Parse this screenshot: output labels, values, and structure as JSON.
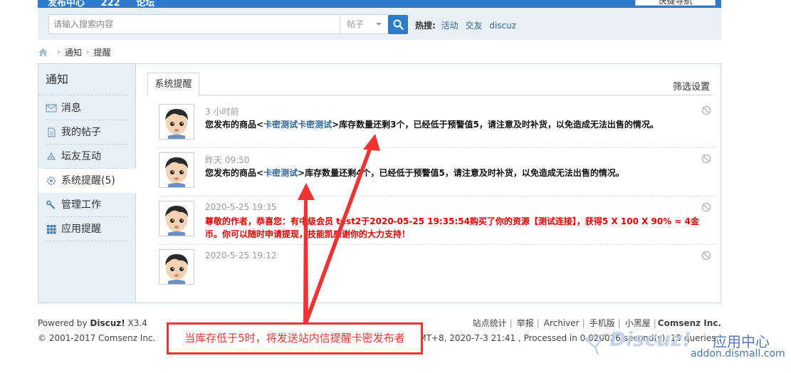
{
  "topbar": {
    "nav": [
      "发布中心",
      "222",
      "论坛"
    ],
    "quick_btn": "快捷导航"
  },
  "search": {
    "placeholder": "请输入搜索内容",
    "type": "帖子",
    "hot_label": "热搜:",
    "hot_keywords": [
      "活动",
      "交友",
      "discuz"
    ]
  },
  "breadcrumb": {
    "items": [
      "通知",
      "提醒"
    ],
    "separator": "›"
  },
  "sidebar": {
    "title": "通知",
    "items": [
      {
        "label": "消息",
        "icon": "mail-icon"
      },
      {
        "label": "我的帖子",
        "icon": "document-icon"
      },
      {
        "label": "坛友互动",
        "icon": "interaction-icon"
      },
      {
        "label": "系统提醒(5)",
        "icon": "gear-icon",
        "active": true
      },
      {
        "label": "管理工作",
        "icon": "wrench-icon"
      },
      {
        "label": "应用提醒",
        "icon": "grid-icon"
      }
    ]
  },
  "tabs": {
    "active": "系统提醒",
    "filter": "筛选设置"
  },
  "notices": [
    {
      "time": "3 小时前",
      "prefix": "您发布的商品<",
      "link": "卡密测试卡密测试",
      "suffix": ">库存数量还剩3个，已经低于预警值5，请注意及时补货，以免造成无法出售的情况。"
    },
    {
      "time": "昨天 09:50",
      "prefix": "您发布的商品<",
      "link": "卡密测试",
      "suffix": ">库存数量还剩4个，已经低于预警值5，请注意及时补货，以免造成无法出售的情况。"
    },
    {
      "time": "2020-5-25 19:35",
      "red_text": "尊敬的作者，恭喜您：有中级会员 test2于2020-05-25 19:35:54购买了你的资源【测试连接】，获得5 X 100 X 90% ≈ 4金币。你可以随时申请提现，技能凯感谢你的大力支持！"
    },
    {
      "time": "2020-5-25 19:12"
    }
  ],
  "footer": {
    "powered_prefix": "Powered by ",
    "powered_brand": "Discuz!",
    "powered_version": " X3.4",
    "copyright": "© 2001-2017 Comsenz Inc.",
    "links": [
      "站点统计",
      "举报",
      "Archiver",
      "手机版",
      "小黑屋"
    ],
    "company": "Comsenz Inc.",
    "gmt": "GMT+8, 2020-7-3 21:41 , Processed in 0.020026 second(s), 15 queries ."
  },
  "annotation": {
    "callout": "当库存低于5时，将发送站内信提醒卡密发布者",
    "color": "#e33333"
  },
  "watermark": {
    "brand": "Discuz!",
    "cn": "应用中心",
    "url": "addon.dismall.com"
  }
}
